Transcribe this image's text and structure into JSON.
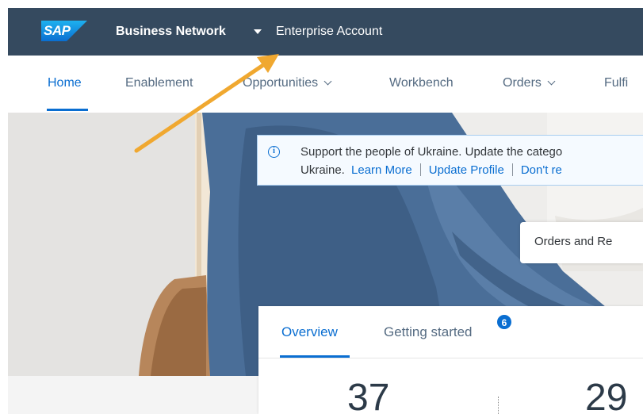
{
  "shellbar": {
    "logo_text": "SAP",
    "product_name": "Business Network",
    "account_name": "Enterprise Account"
  },
  "nav": {
    "items": [
      {
        "label": "Home",
        "active": true
      },
      {
        "label": "Enablement"
      },
      {
        "label": "Opportunities"
      },
      {
        "label": "Workbench"
      },
      {
        "label": "Orders"
      },
      {
        "label": "Fulfi"
      }
    ]
  },
  "banner": {
    "icon": "info-icon",
    "line1": "Support the people of Ukraine. Update the catego",
    "line2_prefix": "Ukraine.",
    "learn_more": "Learn More",
    "update_profile": "Update Profile",
    "dont_remind": "Don't re"
  },
  "orders_card": {
    "label": "Orders and Re"
  },
  "tabs": {
    "overview": "Overview",
    "getting_started": "Getting started",
    "getting_started_badge": "6"
  },
  "stats": {
    "value1": "37",
    "value2": "29"
  },
  "colors": {
    "shellbar": "#354a5f",
    "accent": "#0a6ed1",
    "arrow": "#f0a830"
  }
}
